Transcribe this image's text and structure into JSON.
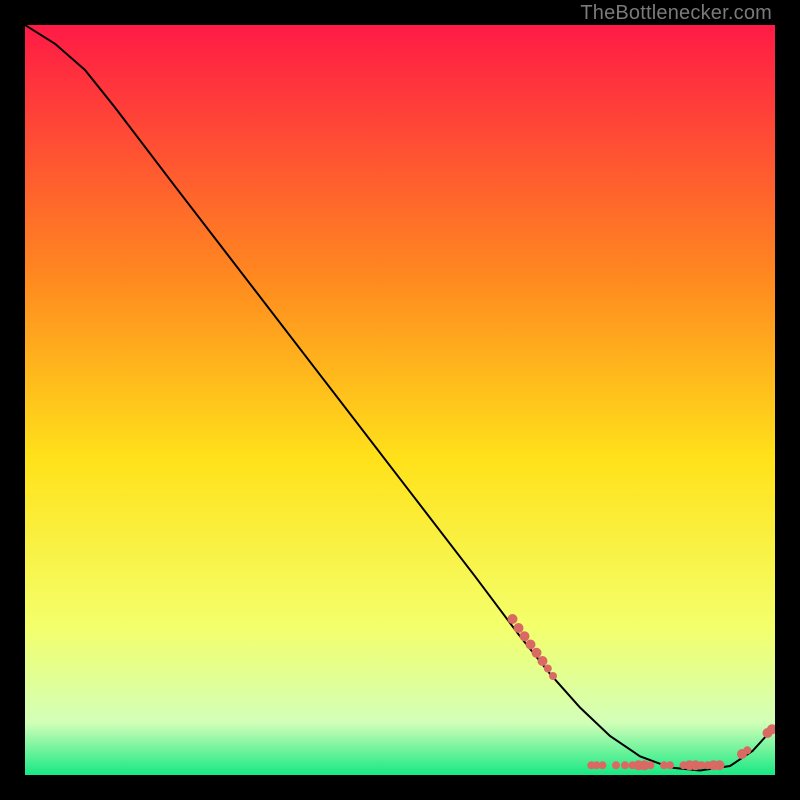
{
  "watermark": "TheBottlenecker.com",
  "chart_data": {
    "type": "line",
    "title": "",
    "xlabel": "",
    "ylabel": "",
    "xlim": [
      0,
      100
    ],
    "ylim": [
      0,
      100
    ],
    "background_gradient": {
      "top": "#ff1a46",
      "upper_mid": "#ff8a1f",
      "mid": "#ffe21a",
      "lower_mid": "#f4ff6a",
      "bottom": "#17e884"
    },
    "series": [
      {
        "name": "bottleneck-curve",
        "color": "#000000",
        "x": [
          0,
          4,
          8,
          12,
          20,
          30,
          40,
          50,
          60,
          66,
          70,
          74,
          78,
          82,
          86,
          90,
          94,
          97,
          100
        ],
        "y": [
          100,
          97.5,
          94,
          89,
          78.5,
          65.5,
          52.5,
          39.5,
          26.5,
          18.5,
          13.5,
          9,
          5.2,
          2.5,
          1.0,
          0.6,
          1.2,
          3.2,
          6.5
        ]
      }
    ],
    "points": {
      "name": "sample-points",
      "color": "#d86a63",
      "radius_small": 4,
      "radius_large": 5,
      "data": [
        {
          "x": 65.0,
          "y": 20.8,
          "r": 5
        },
        {
          "x": 65.8,
          "y": 19.6,
          "r": 5
        },
        {
          "x": 66.6,
          "y": 18.5,
          "r": 5
        },
        {
          "x": 67.4,
          "y": 17.4,
          "r": 5
        },
        {
          "x": 68.2,
          "y": 16.3,
          "r": 5
        },
        {
          "x": 69.0,
          "y": 15.2,
          "r": 5
        },
        {
          "x": 69.7,
          "y": 14.2,
          "r": 4
        },
        {
          "x": 70.4,
          "y": 13.2,
          "r": 4
        },
        {
          "x": 75.5,
          "y": 1.3,
          "r": 4
        },
        {
          "x": 76.2,
          "y": 1.3,
          "r": 4
        },
        {
          "x": 77.0,
          "y": 1.3,
          "r": 4
        },
        {
          "x": 78.8,
          "y": 1.3,
          "r": 4
        },
        {
          "x": 80.0,
          "y": 1.3,
          "r": 4
        },
        {
          "x": 81.0,
          "y": 1.3,
          "r": 4
        },
        {
          "x": 81.8,
          "y": 1.3,
          "r": 5
        },
        {
          "x": 82.6,
          "y": 1.3,
          "r": 5
        },
        {
          "x": 83.4,
          "y": 1.3,
          "r": 4
        },
        {
          "x": 85.2,
          "y": 1.3,
          "r": 4
        },
        {
          "x": 86.0,
          "y": 1.3,
          "r": 4
        },
        {
          "x": 87.8,
          "y": 1.3,
          "r": 4
        },
        {
          "x": 88.6,
          "y": 1.3,
          "r": 5
        },
        {
          "x": 89.4,
          "y": 1.3,
          "r": 5
        },
        {
          "x": 90.2,
          "y": 1.3,
          "r": 4
        },
        {
          "x": 91.0,
          "y": 1.3,
          "r": 4
        },
        {
          "x": 91.8,
          "y": 1.3,
          "r": 5
        },
        {
          "x": 92.6,
          "y": 1.3,
          "r": 5
        },
        {
          "x": 95.6,
          "y": 2.8,
          "r": 5
        },
        {
          "x": 96.3,
          "y": 3.3,
          "r": 4
        },
        {
          "x": 99.0,
          "y": 5.6,
          "r": 5
        },
        {
          "x": 99.6,
          "y": 6.1,
          "r": 5
        }
      ]
    }
  }
}
